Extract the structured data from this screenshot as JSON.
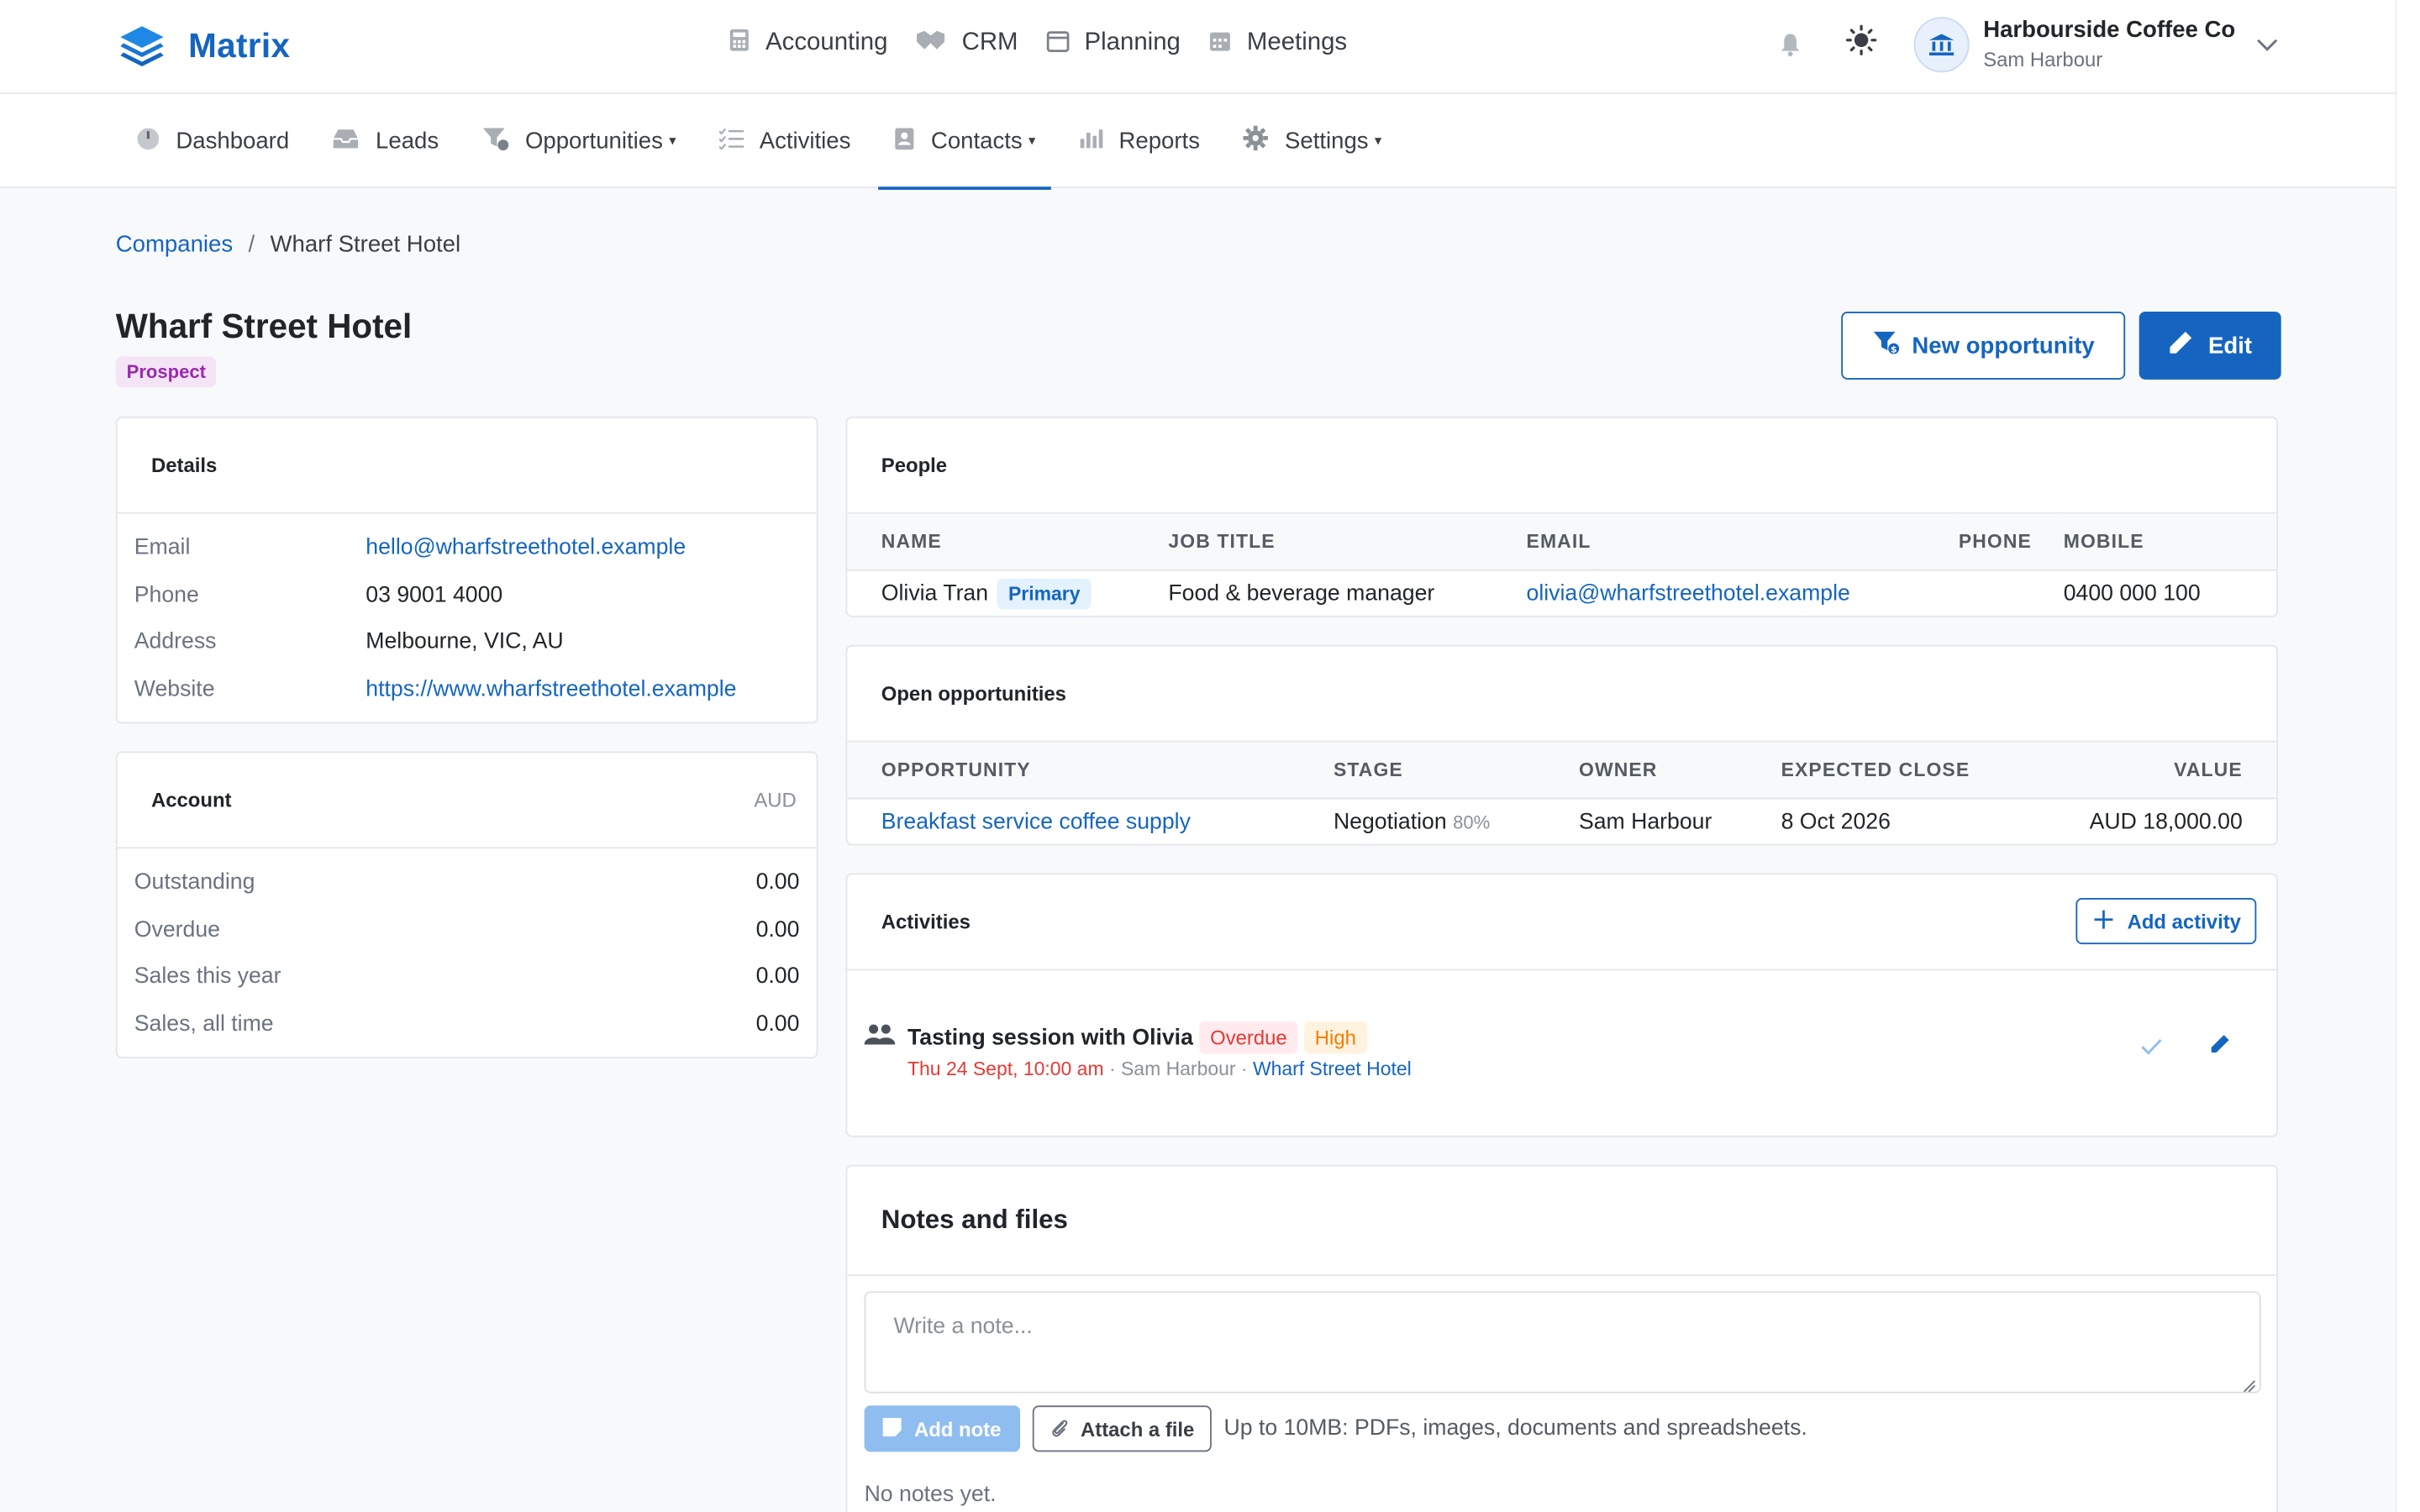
{
  "app": {
    "name": "Matrix"
  },
  "main_nav": [
    {
      "label": "Accounting",
      "icon": "calculator-icon"
    },
    {
      "label": "CRM",
      "icon": "handshake-icon"
    },
    {
      "label": "Planning",
      "icon": "calendar-outline-icon"
    },
    {
      "label": "Meetings",
      "icon": "calendar-grid-icon"
    }
  ],
  "account": {
    "company": "Harbourside Coffee Co",
    "user": "Sam Harbour"
  },
  "sub_nav": [
    {
      "label": "Dashboard",
      "icon": "dashboard-icon"
    },
    {
      "label": "Leads",
      "icon": "inbox-icon"
    },
    {
      "label": "Opportunities",
      "icon": "funnel-icon",
      "has_dropdown": true
    },
    {
      "label": "Activities",
      "icon": "checklist-icon"
    },
    {
      "label": "Contacts",
      "icon": "contact-card-icon",
      "has_dropdown": true,
      "active": true
    },
    {
      "label": "Reports",
      "icon": "bar-chart-icon"
    },
    {
      "label": "Settings",
      "icon": "gear-icon",
      "has_dropdown": true
    }
  ],
  "breadcrumb": {
    "parent": "Companies",
    "separator": "/",
    "current": "Wharf Street Hotel"
  },
  "company": {
    "name": "Wharf Street Hotel",
    "status": "Prospect"
  },
  "actions": {
    "new_opportunity": "New opportunity",
    "edit": "Edit"
  },
  "details": {
    "title": "Details",
    "rows": [
      {
        "label": "Email",
        "value": "hello@wharfstreethotel.example"
      },
      {
        "label": "Phone",
        "value": "03 9001 4000"
      },
      {
        "label": "Address",
        "value": "Melbourne, VIC, AU"
      },
      {
        "label": "Website",
        "value": "https://www.wharfstreethotel.example"
      }
    ]
  },
  "account_card": {
    "title": "Account",
    "currency": "AUD",
    "rows": [
      {
        "label": "Outstanding",
        "value": "0.00"
      },
      {
        "label": "Overdue",
        "value": "0.00"
      },
      {
        "label": "Sales this year",
        "value": "0.00"
      },
      {
        "label": "Sales, all time",
        "value": "0.00"
      }
    ]
  },
  "people": {
    "title": "People",
    "columns": [
      "NAME",
      "JOB TITLE",
      "EMAIL",
      "PHONE",
      "MOBILE"
    ],
    "rows": [
      {
        "name": "Olivia Tran",
        "badge": "Primary",
        "job_title": "Food & beverage manager",
        "email": "olivia@wharfstreethotel.example",
        "phone": "",
        "mobile": "0400 000 100"
      }
    ]
  },
  "opportunities": {
    "title": "Open opportunities",
    "columns": [
      "OPPORTUNITY",
      "STAGE",
      "OWNER",
      "EXPECTED CLOSE",
      "VALUE"
    ],
    "rows": [
      {
        "name": "Breakfast service coffee supply",
        "stage": "Negotiation",
        "probability": "80%",
        "owner": "Sam Harbour",
        "close": "8 Oct 2026",
        "value": "AUD 18,000.00"
      }
    ]
  },
  "activities": {
    "title": "Activities",
    "add_label": "Add activity",
    "items": [
      {
        "title": "Tasting session with Olivia",
        "status": "Overdue",
        "priority": "High",
        "when": "Thu 24 Sept, 10:00 am",
        "sep1": " · ",
        "owner": "Sam Harbour",
        "sep2": " · ",
        "company": "Wharf Street Hotel"
      }
    ]
  },
  "notes": {
    "title": "Notes and files",
    "placeholder": "Write a note...",
    "add_label": "Add note",
    "attach_label": "Attach a file",
    "hint": "Up to 10MB: PDFs, images, documents and spreadsheets.",
    "empty": "No notes yet."
  },
  "colors": {
    "brand": "#1565c0",
    "danger": "#e53935",
    "warning": "#f57c00",
    "prospect": "#9c27b0"
  }
}
